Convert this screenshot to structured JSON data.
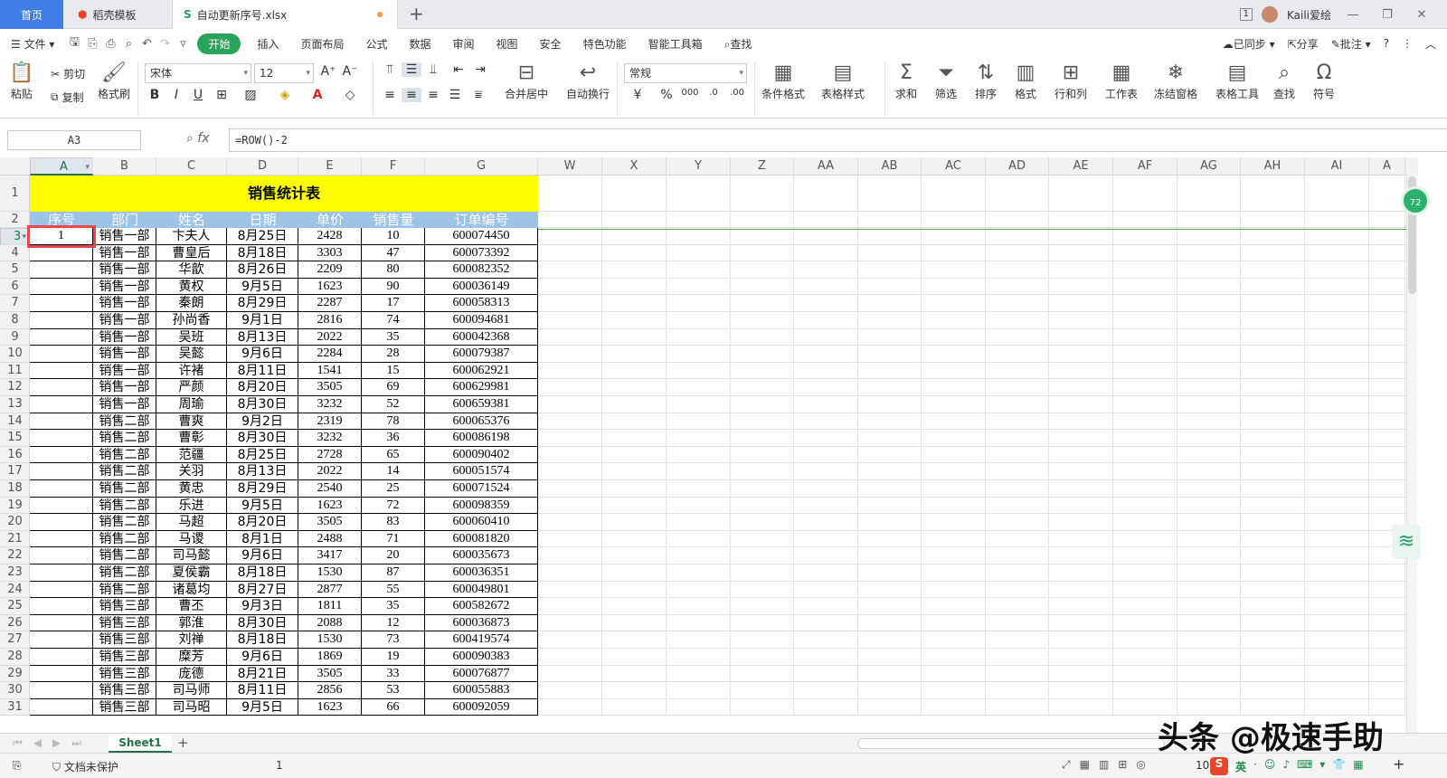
{
  "tabs": {
    "home": "首页",
    "template": "稻壳模板",
    "file": "自动更新序号.xlsx",
    "new_tab": "+"
  },
  "window": {
    "badge": "1",
    "user": "Kaili爱绘"
  },
  "menu": {
    "file": "文件",
    "items": [
      "开始",
      "插入",
      "页面布局",
      "公式",
      "数据",
      "审阅",
      "视图",
      "安全",
      "特色功能",
      "智能工具箱"
    ],
    "search": "查找",
    "sync": "已同步",
    "share": "分享",
    "comment": "批注"
  },
  "ribbon": {
    "paste": "粘贴",
    "cut": "剪切",
    "copy": "复制",
    "format_painter": "格式刷",
    "font_name": "宋体",
    "font_size": "12",
    "merge": "合并居中",
    "wrap": "自动换行",
    "number_format": "常规",
    "cond_format": "条件格式",
    "table_style": "表格样式",
    "sum": "求和",
    "filter": "筛选",
    "sort": "排序",
    "format": "格式",
    "rowcol": "行和列",
    "worksheet": "工作表",
    "freeze": "冻结窗格",
    "table_tools": "表格工具",
    "find": "查找",
    "symbol": "符号"
  },
  "formula_bar": {
    "name_box": "A3",
    "formula": "=ROW()-2"
  },
  "columns": [
    "A",
    "B",
    "C",
    "D",
    "E",
    "F",
    "G",
    "W",
    "X",
    "Y",
    "Z",
    "AA",
    "AB",
    "AC",
    "AD",
    "AE",
    "AF",
    "AG",
    "AH",
    "AI",
    "A"
  ],
  "rows": [
    "1",
    "2",
    "3",
    "4",
    "5",
    "6",
    "7",
    "8",
    "9",
    "10",
    "11",
    "12",
    "13",
    "14",
    "15",
    "16",
    "17",
    "18",
    "19",
    "20",
    "21",
    "22",
    "23",
    "24",
    "25",
    "26",
    "27",
    "28",
    "29",
    "30",
    "31"
  ],
  "sheet": {
    "title": "销售统计表",
    "headers": [
      "序号",
      "部门",
      "姓名",
      "日期",
      "单价",
      "销售量",
      "订单编号"
    ],
    "data": [
      [
        "1",
        "销售一部",
        "卞夫人",
        "8月25日",
        "2428",
        "10",
        "600074450"
      ],
      [
        "",
        "销售一部",
        "曹皇后",
        "8月18日",
        "3303",
        "47",
        "600073392"
      ],
      [
        "",
        "销售一部",
        "华歆",
        "8月26日",
        "2209",
        "80",
        "600082352"
      ],
      [
        "",
        "销售一部",
        "黄权",
        "9月5日",
        "1623",
        "90",
        "600036149"
      ],
      [
        "",
        "销售一部",
        "秦朗",
        "8月29日",
        "2287",
        "17",
        "600058313"
      ],
      [
        "",
        "销售一部",
        "孙尚香",
        "9月1日",
        "2816",
        "74",
        "600094681"
      ],
      [
        "",
        "销售一部",
        "吴班",
        "8月13日",
        "2022",
        "35",
        "600042368"
      ],
      [
        "",
        "销售一部",
        "吴懿",
        "9月6日",
        "2284",
        "28",
        "600079387"
      ],
      [
        "",
        "销售一部",
        "许褚",
        "8月11日",
        "1541",
        "15",
        "600062921"
      ],
      [
        "",
        "销售一部",
        "严颜",
        "8月20日",
        "3505",
        "69",
        "600629981"
      ],
      [
        "",
        "销售一部",
        "周瑜",
        "8月30日",
        "3232",
        "52",
        "600659381"
      ],
      [
        "",
        "销售二部",
        "曹爽",
        "9月2日",
        "2319",
        "78",
        "600065376"
      ],
      [
        "",
        "销售二部",
        "曹彰",
        "8月30日",
        "3232",
        "36",
        "600086198"
      ],
      [
        "",
        "销售二部",
        "范疆",
        "8月25日",
        "2728",
        "65",
        "600090402"
      ],
      [
        "",
        "销售二部",
        "关羽",
        "8月13日",
        "2022",
        "14",
        "600051574"
      ],
      [
        "",
        "销售二部",
        "黄忠",
        "8月29日",
        "2540",
        "25",
        "600071524"
      ],
      [
        "",
        "销售二部",
        "乐进",
        "9月5日",
        "1623",
        "72",
        "600098359"
      ],
      [
        "",
        "销售二部",
        "马超",
        "8月20日",
        "3505",
        "83",
        "600060410"
      ],
      [
        "",
        "销售二部",
        "马谡",
        "8月1日",
        "2488",
        "71",
        "600081820"
      ],
      [
        "",
        "销售二部",
        "司马懿",
        "9月6日",
        "3417",
        "20",
        "600035673"
      ],
      [
        "",
        "销售二部",
        "夏侯霸",
        "8月18日",
        "1530",
        "87",
        "600036351"
      ],
      [
        "",
        "销售二部",
        "诸葛均",
        "8月27日",
        "2877",
        "55",
        "600049801"
      ],
      [
        "",
        "销售三部",
        "曹丕",
        "9月3日",
        "1811",
        "35",
        "600582672"
      ],
      [
        "",
        "销售三部",
        "郭淮",
        "8月30日",
        "2088",
        "12",
        "600036873"
      ],
      [
        "",
        "销售三部",
        "刘禅",
        "8月18日",
        "1530",
        "73",
        "600419574"
      ],
      [
        "",
        "销售三部",
        "糜芳",
        "9月6日",
        "1869",
        "19",
        "600090383"
      ],
      [
        "",
        "销售三部",
        "庞德",
        "8月21日",
        "3505",
        "33",
        "600076877"
      ],
      [
        "",
        "销售三部",
        "司马师",
        "8月11日",
        "2856",
        "53",
        "600055883"
      ],
      [
        "",
        "销售三部",
        "司马昭",
        "9月5日",
        "1623",
        "66",
        "600092059"
      ]
    ]
  },
  "sheet_tab": "Sheet1",
  "status": {
    "protect": "文档未保护",
    "count": "1",
    "zoom": "10",
    "ime": "英"
  },
  "watermark": "头条 @极速手助",
  "bubble": "72",
  "colors": {
    "title_bg": "#ffff00",
    "header_bg": "#9dc3e6",
    "accent": "#27a35a",
    "selection": "#e84848"
  }
}
